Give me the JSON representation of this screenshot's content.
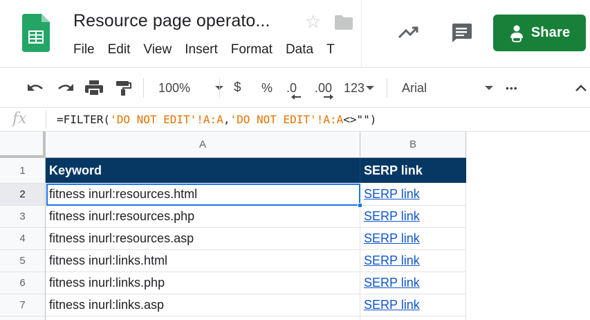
{
  "header": {
    "title": "Resource page operato...",
    "menu": [
      "File",
      "Edit",
      "View",
      "Insert",
      "Format",
      "Data",
      "T"
    ],
    "share_label": "Share",
    "accent_color": "#188038"
  },
  "toolbar": {
    "zoom": "100%",
    "currency": "$",
    "percent": "%",
    "decrease_decimals": ".0",
    "increase_decimals": ".00",
    "more_formats": "123",
    "font": "Arial",
    "more": "•••",
    "icons": [
      "undo-icon",
      "redo-icon",
      "print-icon",
      "paint-format-icon",
      "collapse-icon"
    ]
  },
  "formula_bar": {
    "fx": "fx",
    "prefix": "=FILTER(",
    "arg1": "'DO NOT EDIT'!A:A",
    "comma": ",",
    "arg2": "'DO NOT EDIT'!A:A",
    "op": "<>",
    "end": "\"\")"
  },
  "grid": {
    "columns": [
      "A",
      "B"
    ],
    "row_numbers": [
      "1",
      "2",
      "3",
      "4",
      "5",
      "6",
      "7"
    ],
    "header_row": {
      "keyword": "Keyword",
      "serp": "SERP link",
      "fill_color": "#073763"
    },
    "rows": [
      {
        "keyword": "fitness inurl:resources.html",
        "serp": "SERP link"
      },
      {
        "keyword": "fitness inurl:resources.php",
        "serp": "SERP link"
      },
      {
        "keyword": "fitness inurl:resources.asp",
        "serp": "SERP link"
      },
      {
        "keyword": "fitness inurl:links.html",
        "serp": "SERP link"
      },
      {
        "keyword": "fitness inurl:links.php",
        "serp": "SERP link"
      },
      {
        "keyword": "fitness inurl:links.asp",
        "serp": "SERP link"
      }
    ],
    "selected_cell": "A2"
  }
}
